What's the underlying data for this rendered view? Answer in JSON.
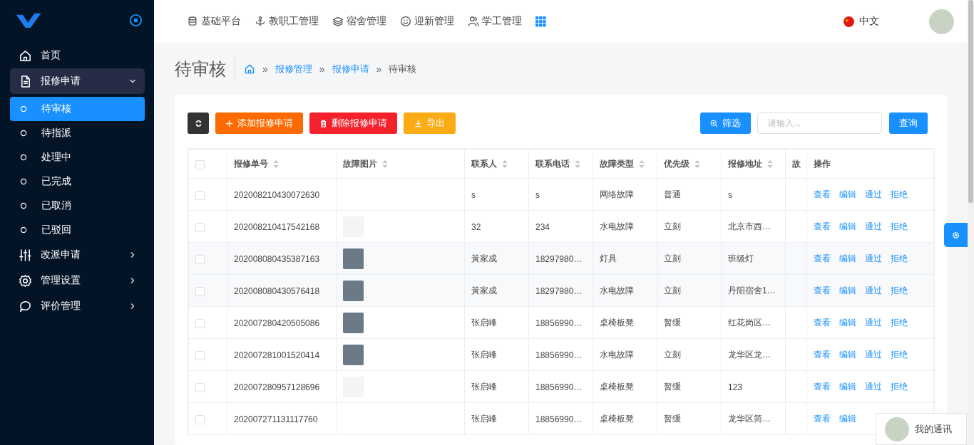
{
  "sidebar": {
    "menu": [
      {
        "label": "首页"
      },
      {
        "label": "报修申请",
        "expanded": true,
        "children": [
          {
            "label": "待审核",
            "selected": true
          },
          {
            "label": "待指派",
            "selected": false
          },
          {
            "label": "处理中",
            "selected": false
          },
          {
            "label": "已完成",
            "selected": false
          },
          {
            "label": "已取消",
            "selected": false
          },
          {
            "label": "已驳回",
            "selected": false
          }
        ]
      },
      {
        "label": "改派申请",
        "expanded": false
      },
      {
        "label": "管理设置",
        "expanded": false
      },
      {
        "label": "评价管理",
        "expanded": false
      }
    ]
  },
  "top_nav": {
    "items": [
      "基础平台",
      "教职工管理",
      "宿舍管理",
      "迎新管理",
      "学工管理"
    ],
    "language": "中文"
  },
  "page": {
    "title": "待审核",
    "breadcrumb": [
      {
        "separator": "»",
        "label": "报修管理",
        "link": true
      },
      {
        "separator": "»",
        "label": "报修申请",
        "link": true
      },
      {
        "separator": "»",
        "label": "待审核",
        "link": false
      }
    ]
  },
  "toolbar": {
    "buttons": [
      {
        "label": "添加报修申请",
        "kind": "add"
      },
      {
        "label": "删除报修申请",
        "kind": "delete"
      },
      {
        "label": "导出",
        "kind": "export"
      }
    ],
    "filter": "筛选",
    "search": {
      "placeholder": "请输入..."
    },
    "query": "查询"
  },
  "table": {
    "header_checked": false,
    "columns": [
      {
        "label": "报修单号",
        "sortable": true
      },
      {
        "label": "故障图片",
        "sortable": true
      },
      {
        "label": "联系人",
        "sortable": true
      },
      {
        "label": "联系电话",
        "sortable": true
      },
      {
        "label": "故障类型",
        "sortable": true
      },
      {
        "label": "优先级",
        "sortable": true
      },
      {
        "label": "报修地址",
        "sortable": true
      },
      {
        "label": "故",
        "sortable": false
      },
      {
        "label": "操作",
        "sortable": false
      }
    ],
    "rows": [
      {
        "checked": false,
        "highlighted": false,
        "kind": "plain",
        "cells": [
          "202008210430072630",
          "",
          "s",
          "s",
          "网络故障",
          "普通",
          "s",
          ""
        ],
        "actions": [
          "查看",
          "编辑",
          "通过",
          "拒绝"
        ]
      },
      {
        "checked": false,
        "highlighted": false,
        "kind": "broken",
        "cells": [
          "202008210417542168",
          "",
          "32",
          "234",
          "水电故障",
          "立刻",
          "北京市西…",
          ""
        ],
        "actions": [
          "查看",
          "编辑",
          "通过",
          "拒绝"
        ]
      },
      {
        "checked": false,
        "highlighted": true,
        "kind": "photo",
        "cells": [
          "202008080435387163",
          "",
          "黃家成",
          "18297980…",
          "灯具",
          "立刻",
          "班级灯",
          ""
        ],
        "actions": [
          "查看",
          "编辑",
          "通过",
          "拒绝"
        ]
      },
      {
        "checked": false,
        "highlighted": true,
        "kind": "photo",
        "cells": [
          "202008080430576418",
          "",
          "黃家成",
          "18297980…",
          "水电故障",
          "立刻",
          "丹阳宿舍1…",
          ""
        ],
        "actions": [
          "查看",
          "编辑",
          "通过",
          "拒绝"
        ]
      },
      {
        "checked": false,
        "highlighted": false,
        "kind": "photo",
        "cells": [
          "202007280420505086",
          "",
          "张启峰",
          "18856990…",
          "桌椅板凳",
          "暂缓",
          "红花岗区…",
          ""
        ],
        "actions": [
          "查看",
          "编辑",
          "通过",
          "拒绝"
        ]
      },
      {
        "checked": false,
        "highlighted": false,
        "kind": "photo",
        "cells": [
          "202007281001520414",
          "",
          "张启峰",
          "18856990…",
          "水电故障",
          "立刻",
          "龙华区龙…",
          ""
        ],
        "actions": [
          "查看",
          "编辑",
          "通过",
          "拒绝"
        ]
      },
      {
        "checked": false,
        "highlighted": false,
        "kind": "broken",
        "cells": [
          "202007280957128696",
          "",
          "张启峰",
          "18856990…",
          "桌椅板凳",
          "暂缓",
          "123",
          ""
        ],
        "actions": [
          "查看",
          "编辑",
          "通过",
          "拒绝"
        ]
      },
      {
        "checked": false,
        "highlighted": false,
        "kind": "plain",
        "cells": [
          "202007271131117760",
          "",
          "张启峰",
          "18856990…",
          "桌椅板凳",
          "暂缓",
          "龙华区简…",
          ""
        ],
        "actions": [
          "查看",
          "编辑"
        ]
      }
    ]
  },
  "chat_widget": {
    "label": "我的通讯"
  }
}
